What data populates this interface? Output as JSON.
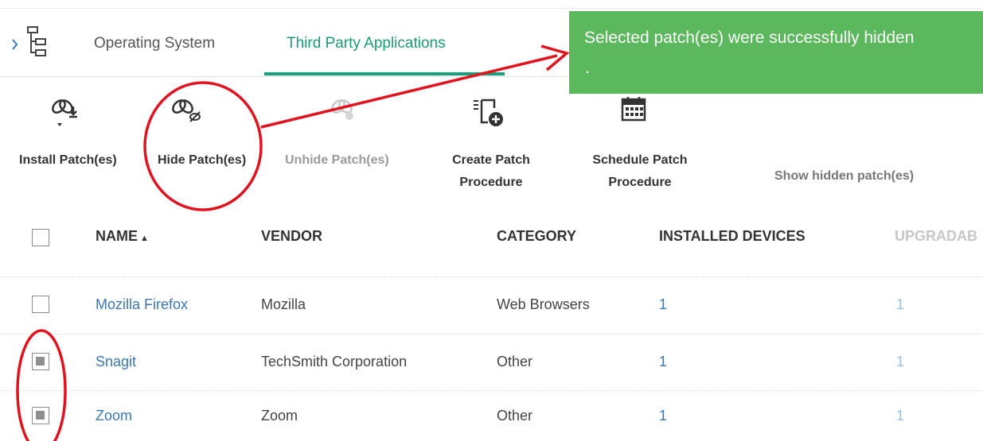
{
  "tabs": [
    {
      "label": "Operating System"
    },
    {
      "label": "Third Party Applications"
    }
  ],
  "toast": {
    "message": "Selected patch(es) were successfully hidden",
    "trailing": "."
  },
  "toolbar": {
    "install_label": "Install Patch(es)",
    "hide_label": "Hide Patch(es)",
    "unhide_label": "Unhide Patch(es)",
    "create_line1": "Create Patch",
    "create_line2": "Procedure",
    "schedule_line1": "Schedule Patch",
    "schedule_line2": "Procedure",
    "show_hidden_label": "Show hidden patch(es)",
    "icons": [
      "install-patch-icon",
      "hide-patch-icon",
      "unhide-patch-icon",
      "create-procedure-icon",
      "calendar-icon"
    ]
  },
  "table": {
    "headers": {
      "name": "NAME",
      "vendor": "VENDOR",
      "category": "CATEGORY",
      "installed": "INSTALLED DEVICES",
      "upgradable": "UPGRADAB"
    },
    "rows": [
      {
        "name": "Mozilla Firefox",
        "vendor": "Mozilla",
        "category": "Web Browsers",
        "installed": "1",
        "upgradable": "1",
        "checked": false
      },
      {
        "name": "Snagit",
        "vendor": "TechSmith Corporation",
        "category": "Other",
        "installed": "1",
        "upgradable": "1",
        "checked": true
      },
      {
        "name": "Zoom",
        "vendor": "Zoom",
        "category": "Other",
        "installed": "1",
        "upgradable": "1",
        "checked": true
      }
    ]
  },
  "colors": {
    "accent": "#14a07a",
    "toast_bg": "#5cb85c",
    "link": "#3a77b3",
    "annotation": "#e0141e"
  }
}
